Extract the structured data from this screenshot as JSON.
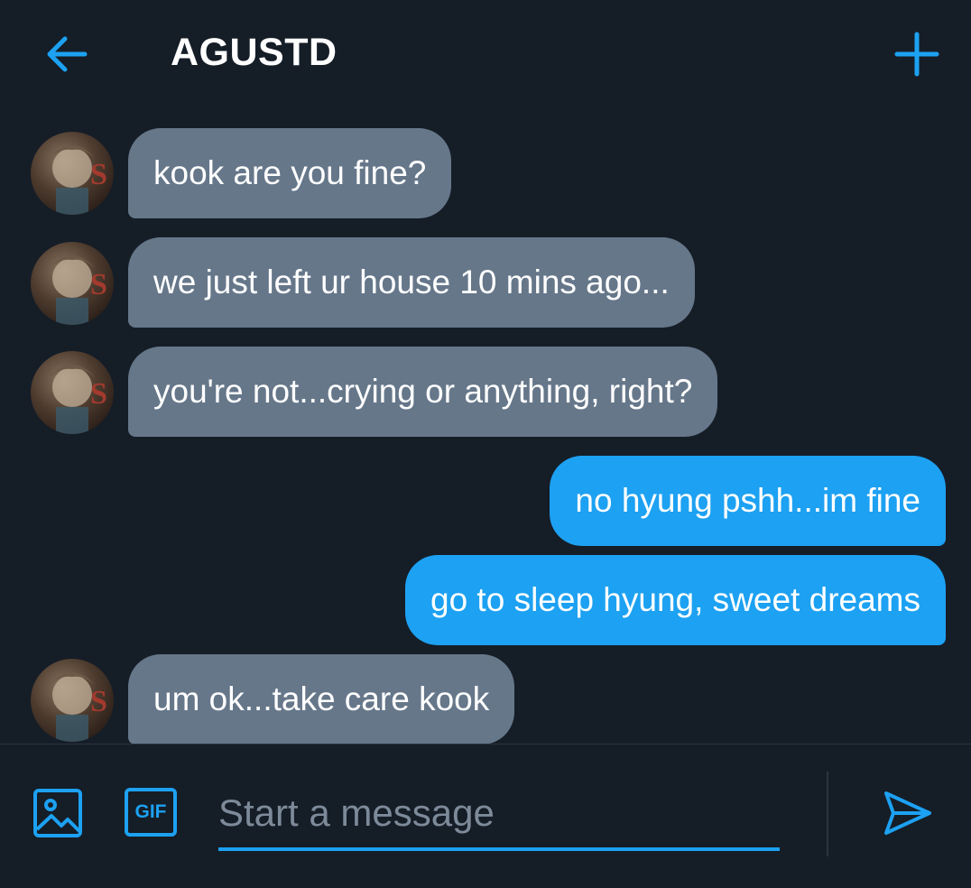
{
  "header": {
    "title": "AGUSTD",
    "back_icon": "arrow-left-icon",
    "new_icon": "plus-icon"
  },
  "messages": [
    {
      "direction": "in",
      "text": "kook are you fine?"
    },
    {
      "direction": "in",
      "text": "we just left ur house 10 mins ago..."
    },
    {
      "direction": "in",
      "text": "you're not...crying or anything, right?"
    },
    {
      "direction": "out",
      "text": "no hyung pshh...im fine"
    },
    {
      "direction": "out",
      "text": "go to sleep hyung, sweet dreams"
    },
    {
      "direction": "in",
      "text": "um ok...take care kook"
    }
  ],
  "composer": {
    "image_icon": "image-icon",
    "gif_label": "GIF",
    "placeholder": "Start a message",
    "send_icon": "send-icon"
  },
  "colors": {
    "background": "#151d27",
    "accent": "#1da1f2",
    "incoming_bubble": "#66778a",
    "outgoing_bubble": "#1da1f2"
  }
}
